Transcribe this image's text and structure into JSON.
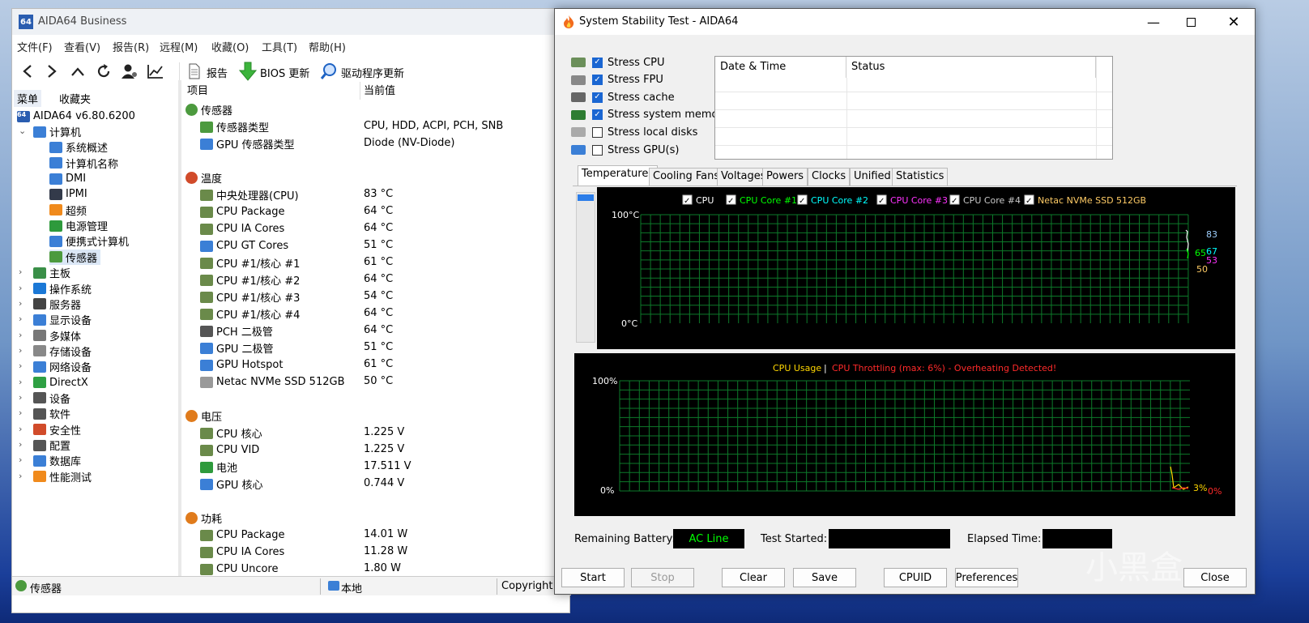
{
  "main": {
    "title": "AIDA64 Business",
    "app_icon_text": "64",
    "menu": [
      "文件(F)",
      "查看(V)",
      "报告(R)",
      "远程(M)",
      "收藏(O)",
      "工具(T)",
      "帮助(H)"
    ],
    "toolbar": {
      "report": "报告",
      "bios_update": "BIOS 更新",
      "driver_update": "驱动程序更新"
    },
    "left_tabs": [
      "菜单",
      "收藏夹"
    ],
    "tree_root": "AIDA64 v6.80.6200",
    "tree": [
      {
        "label": "计算机",
        "level": 1,
        "expander": "⌄",
        "color": "#3b7fd6"
      },
      {
        "label": "系统概述",
        "level": 2,
        "color": "#3b7fd6"
      },
      {
        "label": "计算机名称",
        "level": 2,
        "color": "#3b7fd6"
      },
      {
        "label": "DMI",
        "level": 2,
        "color": "#3b7fd6"
      },
      {
        "label": "IPMI",
        "level": 2,
        "color": "#333a4a"
      },
      {
        "label": "超频",
        "level": 2,
        "color": "#f08a1c"
      },
      {
        "label": "电源管理",
        "level": 2,
        "color": "#2e9a3c"
      },
      {
        "label": "便携式计算机",
        "level": 2,
        "color": "#3b7fd6"
      },
      {
        "label": "传感器",
        "level": 2,
        "color": "#4c9a3e",
        "selected": true
      },
      {
        "label": "主板",
        "level": 1,
        "expander": "›",
        "color": "#3a8f48"
      },
      {
        "label": "操作系统",
        "level": 1,
        "expander": "›",
        "color": "#1b78d6"
      },
      {
        "label": "服务器",
        "level": 1,
        "expander": "›",
        "color": "#444"
      },
      {
        "label": "显示设备",
        "level": 1,
        "expander": "›",
        "color": "#3b7fd6"
      },
      {
        "label": "多媒体",
        "level": 1,
        "expander": "›",
        "color": "#777"
      },
      {
        "label": "存储设备",
        "level": 1,
        "expander": "›",
        "color": "#888"
      },
      {
        "label": "网络设备",
        "level": 1,
        "expander": "›",
        "color": "#3b7fd6"
      },
      {
        "label": "DirectX",
        "level": 1,
        "expander": "›",
        "color": "#2ea043"
      },
      {
        "label": "设备",
        "level": 1,
        "expander": "›",
        "color": "#555"
      },
      {
        "label": "软件",
        "level": 1,
        "expander": "›",
        "color": "#555"
      },
      {
        "label": "安全性",
        "level": 1,
        "expander": "›",
        "color": "#d14b2a"
      },
      {
        "label": "配置",
        "level": 1,
        "expander": "›",
        "color": "#555"
      },
      {
        "label": "数据库",
        "level": 1,
        "expander": "›",
        "color": "#3b7fd6"
      },
      {
        "label": "性能测试",
        "level": 1,
        "expander": "›",
        "color": "#f08a1c"
      }
    ],
    "list_headers": [
      "项目",
      "当前值"
    ],
    "sections": [
      {
        "title": "传感器",
        "icon_color": "#4c9a3e",
        "rows": [
          {
            "item": "传感器类型",
            "value": "CPU, HDD, ACPI, PCH, SNB",
            "color": "#4c9a3e"
          },
          {
            "item": "GPU 传感器类型",
            "value": "Diode  (NV-Diode)",
            "color": "#3b7fd6"
          }
        ]
      },
      {
        "title": "温度",
        "icon_color": "#d14b2a",
        "rows": [
          {
            "item": "中央处理器(CPU)",
            "value": "83 °C",
            "color": "#6a8a4a"
          },
          {
            "item": "CPU Package",
            "value": "64 °C",
            "color": "#6a8a4a"
          },
          {
            "item": "CPU IA Cores",
            "value": "64 °C",
            "color": "#6a8a4a"
          },
          {
            "item": "CPU GT Cores",
            "value": "51 °C",
            "color": "#3b7fd6"
          },
          {
            "item": "CPU #1/核心 #1",
            "value": "61 °C",
            "color": "#6a8a4a"
          },
          {
            "item": "CPU #1/核心 #2",
            "value": "64 °C",
            "color": "#6a8a4a"
          },
          {
            "item": "CPU #1/核心 #3",
            "value": "54 °C",
            "color": "#6a8a4a"
          },
          {
            "item": "CPU #1/核心 #4",
            "value": "64 °C",
            "color": "#6a8a4a"
          },
          {
            "item": "PCH 二极管",
            "value": "64 °C",
            "color": "#555"
          },
          {
            "item": "GPU 二极管",
            "value": "51 °C",
            "color": "#3b7fd6"
          },
          {
            "item": "GPU Hotspot",
            "value": "61 °C",
            "color": "#3b7fd6"
          },
          {
            "item": "Netac NVMe SSD 512GB",
            "value": "50 °C",
            "color": "#999"
          }
        ]
      },
      {
        "title": "电压",
        "icon_color": "#e07b1c",
        "rows": [
          {
            "item": "CPU 核心",
            "value": "1.225 V",
            "color": "#6a8a4a"
          },
          {
            "item": "CPU VID",
            "value": "1.225 V",
            "color": "#6a8a4a"
          },
          {
            "item": "电池",
            "value": "17.511 V",
            "color": "#2e9a3c"
          },
          {
            "item": "GPU 核心",
            "value": "0.744 V",
            "color": "#3b7fd6"
          }
        ]
      },
      {
        "title": "功耗",
        "icon_color": "#e07b1c",
        "rows": [
          {
            "item": "CPU Package",
            "value": "14.01 W",
            "color": "#6a8a4a"
          },
          {
            "item": "CPU IA Cores",
            "value": "11.28 W",
            "color": "#6a8a4a"
          },
          {
            "item": "CPU Uncore",
            "value": "1.80 W",
            "color": "#6a8a4a"
          }
        ]
      }
    ],
    "status": {
      "left": "传感器",
      "mid": "本地",
      "right": "Copyright"
    }
  },
  "sst": {
    "title": "System Stability Test - AIDA64",
    "stress": [
      {
        "label": "Stress CPU",
        "checked": true,
        "icon_color": "#6b8f5a"
      },
      {
        "label": "Stress FPU",
        "checked": true,
        "icon_color": "#888"
      },
      {
        "label": "Stress cache",
        "checked": true,
        "icon_color": "#666"
      },
      {
        "label": "Stress system memory",
        "checked": true,
        "icon_color": "#2e7d32"
      },
      {
        "label": "Stress local disks",
        "checked": false,
        "icon_color": "#aaa"
      },
      {
        "label": "Stress GPU(s)",
        "checked": false,
        "icon_color": "#3b7fd6"
      }
    ],
    "log_headers": [
      "Date & Time",
      "Status"
    ],
    "tabs": [
      "Temperatures",
      "Cooling Fans",
      "Voltages",
      "Powers",
      "Clocks",
      "Unified",
      "Statistics"
    ],
    "legend": [
      {
        "label": "CPU",
        "color": "#ffffff"
      },
      {
        "label": "CPU Core #1",
        "color": "#00ff00"
      },
      {
        "label": "CPU Core #2",
        "color": "#00ffff"
      },
      {
        "label": "CPU Core #3",
        "color": "#ff33ff"
      },
      {
        "label": "CPU Core #4",
        "color": "#c8c8c8"
      },
      {
        "label": "Netac NVMe SSD 512GB",
        "color": "#ffcc66"
      }
    ],
    "temp_ymax_label": "100°C",
    "temp_ymin_label": "0°C",
    "temp_readouts": [
      {
        "text": "83",
        "color": "#9fd0ff"
      },
      {
        "text": "67",
        "color": "#00ffff"
      },
      {
        "text": "65",
        "color": "#00ff00"
      },
      {
        "text": "53",
        "color": "#ff33ff"
      },
      {
        "text": "50",
        "color": "#ffcc66"
      }
    ],
    "usage_title": "CPU Usage",
    "usage_sep": "|",
    "throttle_title": "CPU Throttling (max: 6%) - Overheating Detected!",
    "usage_ymax_label": "100%",
    "usage_ymin_label": "0%",
    "usage_readout": "3%",
    "throttle_readout": "0%",
    "remaining_battery_label": "Remaining Battery:",
    "ac_line": "AC Line",
    "test_started_label": "Test Started:",
    "elapsed_label": "Elapsed Time:",
    "buttons": {
      "start": "Start",
      "stop": "Stop",
      "clear": "Clear",
      "save": "Save",
      "cpuid": "CPUID",
      "preferences": "Preferences",
      "close": "Close"
    }
  },
  "watermark": "小黑盒"
}
